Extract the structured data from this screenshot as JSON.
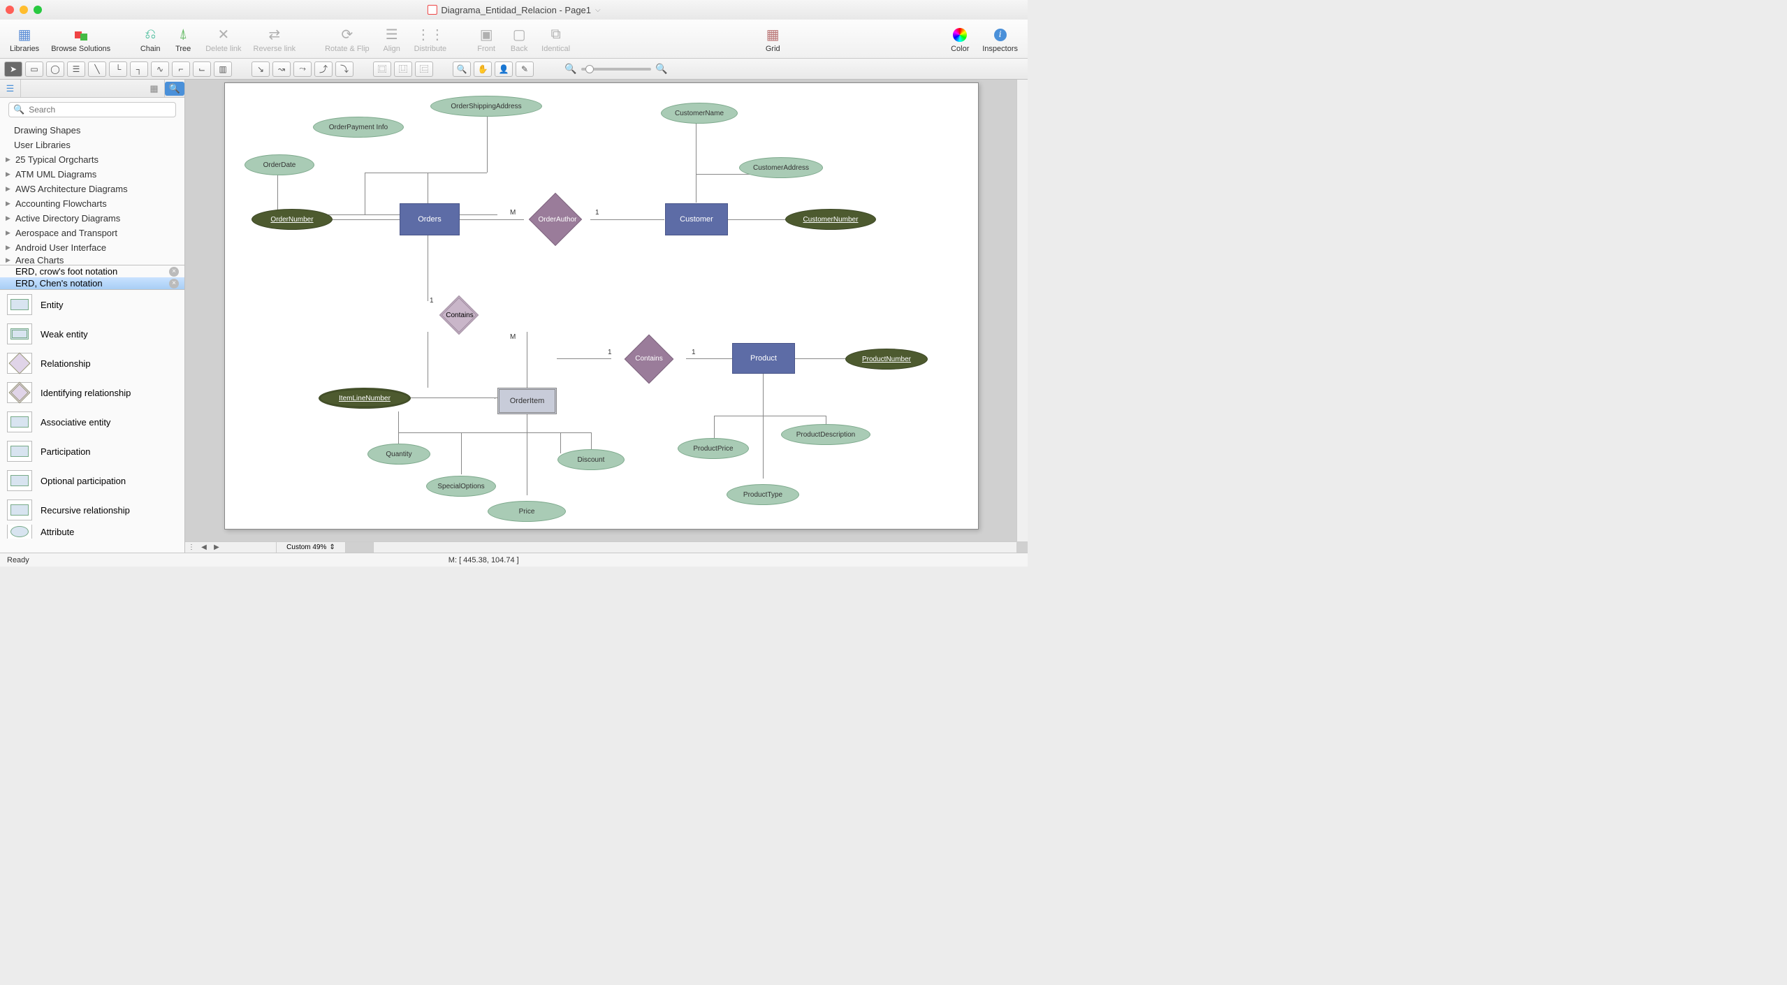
{
  "window": {
    "title": "Diagrama_Entidad_Relacion - Page1"
  },
  "toolbar": {
    "libraries": "Libraries",
    "browse": "Browse Solutions",
    "chain": "Chain",
    "tree": "Tree",
    "delete_link": "Delete link",
    "reverse_link": "Reverse link",
    "rotate_flip": "Rotate & Flip",
    "align": "Align",
    "distribute": "Distribute",
    "front": "Front",
    "back": "Back",
    "identical": "Identical",
    "grid": "Grid",
    "color": "Color",
    "inspectors": "Inspectors"
  },
  "sidebar": {
    "search_placeholder": "Search",
    "tree": [
      "Drawing Shapes",
      "User Libraries",
      "25 Typical Orgcharts",
      "ATM UML Diagrams",
      "AWS Architecture Diagrams",
      "Accounting Flowcharts",
      "Active Directory Diagrams",
      "Aerospace and Transport",
      "Android User Interface",
      "Area Charts"
    ],
    "libtabs": {
      "crow": "ERD, crow's foot notation",
      "chen": "ERD, Chen's notation"
    },
    "shapes": [
      "Entity",
      "Weak entity",
      "Relationship",
      "Identifying relationship",
      "Associative entity",
      "Participation",
      "Optional participation",
      "Recursive relationship",
      "Attribute"
    ]
  },
  "erd": {
    "orders": "Orders",
    "customer": "Customer",
    "product": "Product",
    "orderitem": "OrderItem",
    "order_author": "OrderAuthor",
    "contains1": "Contains",
    "contains2": "Contains",
    "order_number": "OrderNumber",
    "order_date": "OrderDate",
    "order_payment_info": "OrderPayment Info",
    "order_shipping_address": "OrderShippingAddress",
    "customer_name": "CustomerName",
    "customer_address": "CustomerAddress",
    "customer_number": "CustomerNumber",
    "item_line_number": "ItemLineNumber",
    "quantity": "Quantity",
    "special_options": "SpecialOptions",
    "price": "Price",
    "discount": "Discount",
    "product_number": "ProductNumber",
    "product_description": "ProductDescription",
    "product_price": "ProductPrice",
    "product_type": "ProductType",
    "card_M": "M",
    "card_1": "1"
  },
  "footer": {
    "zoom_label": "Custom 49%",
    "status": "Ready",
    "mouse": "M: [ 445.38, 104.74 ]"
  }
}
